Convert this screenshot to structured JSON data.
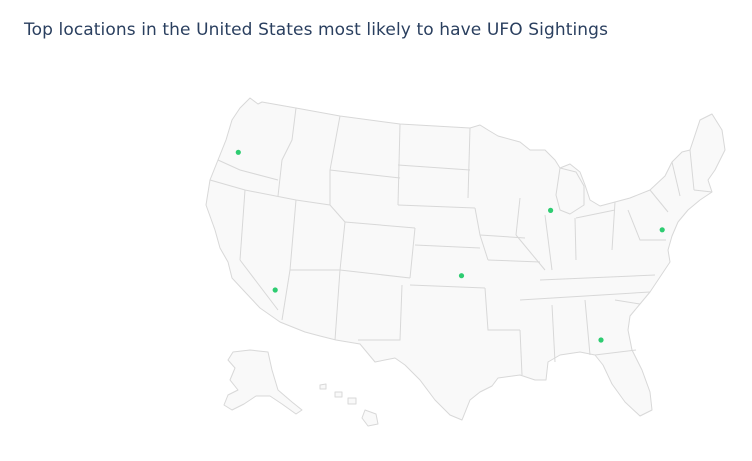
{
  "title": "Top locations in the United States most likely to have UFO Sightings",
  "chart_data": {
    "type": "scattergeo",
    "scope": "usa",
    "marker_color": "#2ecc71",
    "land_color": "#f9f9f9",
    "border_color": "#d8d8d8",
    "points": [
      {
        "lon": -122.3,
        "lat": 47.6
      },
      {
        "lon": -118.2,
        "lat": 34.1
      },
      {
        "lon": -97.5,
        "lat": 35.5
      },
      {
        "lon": -87.6,
        "lat": 41.9
      },
      {
        "lon": -75.2,
        "lat": 40.0
      },
      {
        "lon": -82.0,
        "lat": 29.2
      }
    ]
  }
}
